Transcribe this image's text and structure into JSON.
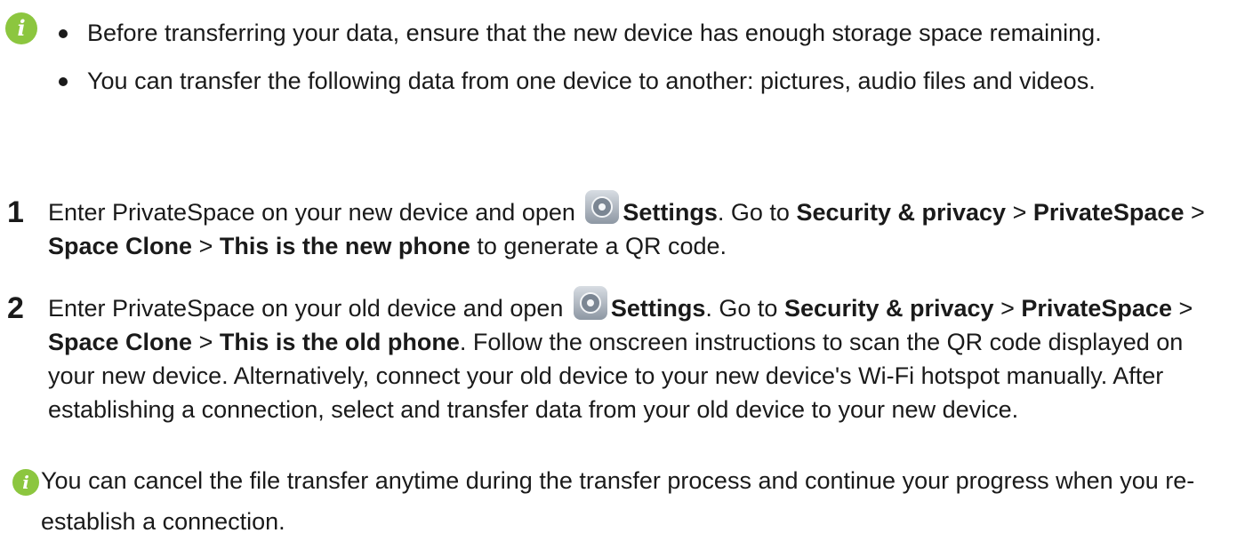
{
  "tips": {
    "icon": "info-icon",
    "icon_color": "#8cc63f",
    "items": [
      "Before transferring your data, ensure that the new device has enough storage space remaining.",
      "You can transfer the following data from one device to another: pictures, audio files and videos."
    ]
  },
  "steps": [
    {
      "number": "1",
      "parts": {
        "t1": "Enter PrivateSpace on your new device and open ",
        "b1": "Settings",
        "t2": ". Go to ",
        "b2": "Security & privacy",
        "t3": " > ",
        "b3": "PrivateSpace",
        "t4": " > ",
        "b4": "Space Clone",
        "t5": " > ",
        "b5": "This is the new phone",
        "t6": " to generate a QR code."
      }
    },
    {
      "number": "2",
      "parts": {
        "t1": "Enter PrivateSpace on your old device and open ",
        "b1": "Settings",
        "t2": ". Go to ",
        "b2": "Security & privacy",
        "t3": " > ",
        "b3": "PrivateSpace",
        "t4": " > ",
        "b4": "Space Clone",
        "t5": " > ",
        "b5": "This is the old phone",
        "t6": ". Follow the onscreen instructions to scan the QR code displayed on your new device. Alternatively, connect your old device to your new device's Wi-Fi hotspot manually. After establishing a connection, select and transfer data from your old device to your new device."
      }
    }
  ],
  "note": {
    "icon": "info-icon",
    "text": "You can cancel the file transfer anytime during the transfer process and continue your progress when you re-establish a connection."
  },
  "settings_icon": "settings-gear-icon"
}
